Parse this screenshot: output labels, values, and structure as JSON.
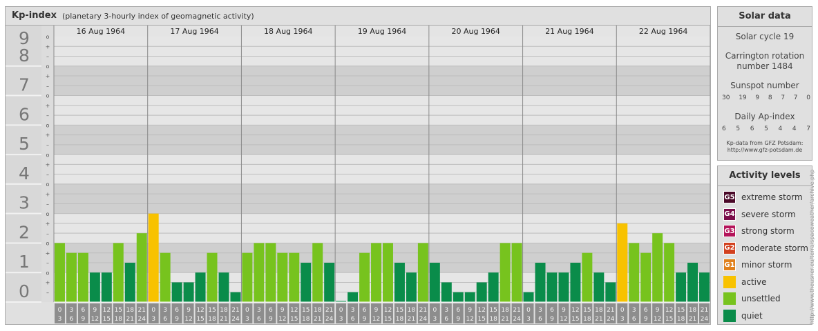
{
  "header": {
    "title": "Kp-index",
    "subtitle": "(planetary 3-hourly index of geomagnetic activity)"
  },
  "chart_data": {
    "type": "bar",
    "title": "Kp-index",
    "subtitle": "(planetary 3-hourly index of geomagnetic activity)",
    "ylim": [
      0,
      9
    ],
    "y_ticks": [
      "0",
      "1",
      "2",
      "3",
      "4",
      "5",
      "6",
      "7",
      "8",
      "9"
    ],
    "minor_tick_marks": [
      "–",
      "+",
      "o"
    ],
    "dates": [
      "16 Aug 1964",
      "17 Aug 1964",
      "18 Aug 1964",
      "19 Aug 1964",
      "20 Aug 1964",
      "21 Aug 1964",
      "22 Aug 1964"
    ],
    "interval_labels": [
      [
        "0",
        "3"
      ],
      [
        "3",
        "6"
      ],
      [
        "6",
        "9"
      ],
      [
        "9",
        "12"
      ],
      [
        "12",
        "15"
      ],
      [
        "15",
        "18"
      ],
      [
        "18",
        "21"
      ],
      [
        "21",
        "24"
      ]
    ],
    "values": [
      [
        2.0,
        1.667,
        1.667,
        1.0,
        1.0,
        2.0,
        1.333,
        2.333
      ],
      [
        3.0,
        1.667,
        0.667,
        0.667,
        1.0,
        1.667,
        1.0,
        0.333
      ],
      [
        1.667,
        2.0,
        2.0,
        1.667,
        1.667,
        1.333,
        2.0,
        1.333
      ],
      [
        0.0,
        0.333,
        1.667,
        2.0,
        2.0,
        1.333,
        1.0,
        2.0
      ],
      [
        1.333,
        0.667,
        0.333,
        0.333,
        0.667,
        1.0,
        2.0,
        2.0
      ],
      [
        0.333,
        1.333,
        1.0,
        1.0,
        1.333,
        1.667,
        1.0,
        0.667
      ],
      [
        2.667,
        2.0,
        1.667,
        2.333,
        2.0,
        1.0,
        1.333,
        1.0
      ]
    ],
    "grid": true
  },
  "colors": {
    "quiet": "#0a8c4a",
    "unsettled": "#77c31e",
    "active": "#f8c200",
    "minor_storm": "#e0801c",
    "moderate_storm": "#d2401e",
    "strong_storm": "#b4145a",
    "severe_storm": "#7a0c4a",
    "extreme_storm": "#4a0828",
    "axis_label": "#777777"
  },
  "solar_data": {
    "title": "Solar data",
    "solar_cycle": "Solar cycle 19",
    "carrington_line1": "Carrington rotation",
    "carrington_line2": "number 1484",
    "sunspot_title": "Sunspot number",
    "sunspot_values": [
      "30",
      "19",
      "9",
      "8",
      "7",
      "7",
      "0"
    ],
    "ap_title": "Daily Ap-index",
    "ap_values": [
      "6",
      "5",
      "6",
      "5",
      "4",
      "4",
      "7"
    ],
    "source_line1": "Kp-data from GFZ Potsdam:",
    "source_line2": "http://www.gfz-potsdam.de"
  },
  "activity_levels": {
    "title": "Activity levels",
    "items": [
      {
        "badge": "G5",
        "label": "extreme storm",
        "color": "#4a0828"
      },
      {
        "badge": "G4",
        "label": "severe storm",
        "color": "#7a0c4a"
      },
      {
        "badge": "G3",
        "label": "strong storm",
        "color": "#b4145a"
      },
      {
        "badge": "G2",
        "label": "moderate storm",
        "color": "#d2401e"
      },
      {
        "badge": "G1",
        "label": "minor storm",
        "color": "#e0801c"
      },
      {
        "badge": "",
        "label": "active",
        "color": "#f8c200"
      },
      {
        "badge": "",
        "label": "unsettled",
        "color": "#77c31e"
      },
      {
        "badge": "",
        "label": "quiet",
        "color": "#0a8c4a"
      }
    ]
  },
  "watermark": "http://www.theusner.eu/terra/spaceweather/archive.php"
}
